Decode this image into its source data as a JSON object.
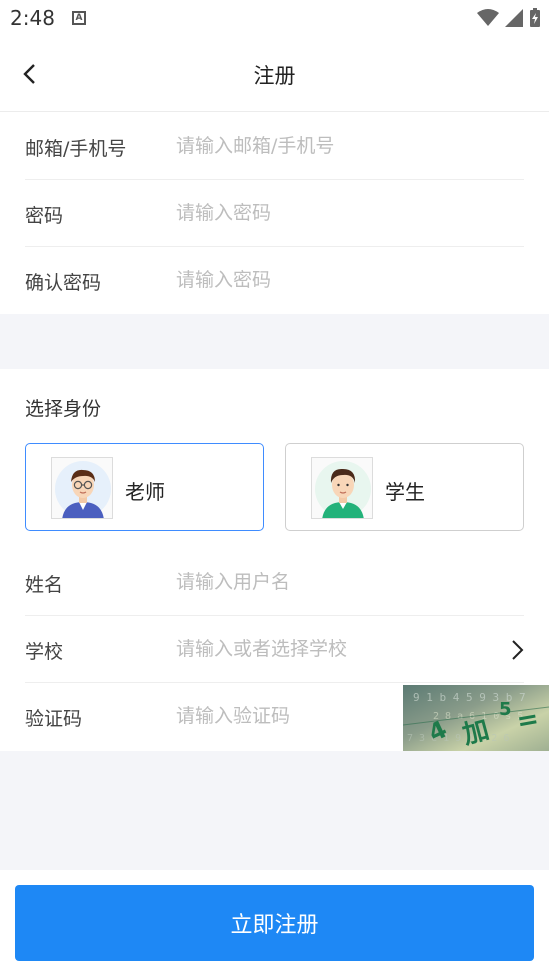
{
  "status": {
    "time": "2:48",
    "a_badge": "A"
  },
  "header": {
    "title": "注册"
  },
  "form": {
    "email": {
      "label": "邮箱/手机号",
      "placeholder": "请输入邮箱/手机号"
    },
    "password": {
      "label": "密码",
      "placeholder": "请输入密码"
    },
    "confirm": {
      "label": "确认密码",
      "placeholder": "请输入密码"
    }
  },
  "identity": {
    "title": "选择身份",
    "teacher": "老师",
    "student": "学生",
    "selected": "老师"
  },
  "details": {
    "name": {
      "label": "姓名",
      "placeholder": "请输入用户名"
    },
    "school": {
      "label": "学校",
      "placeholder": "请输入或者选择学校"
    },
    "captcha": {
      "label": "验证码",
      "placeholder": "请输入验证码"
    }
  },
  "captcha_image_text": "4加5=",
  "submit": "立即注册",
  "colors": {
    "accent": "#1e88f5",
    "selected_border": "#3f8cff",
    "gap": "#f4f5f9"
  }
}
